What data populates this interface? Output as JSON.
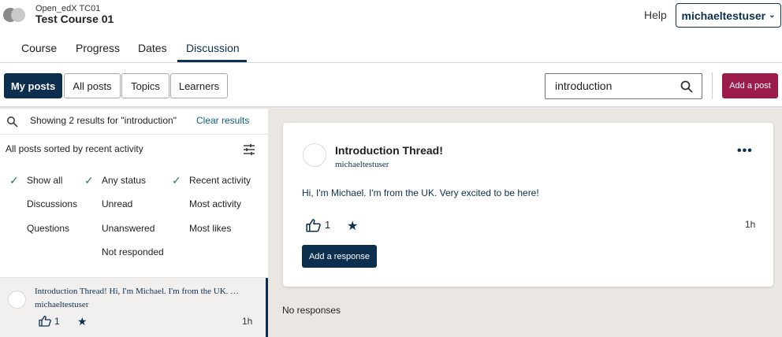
{
  "header": {
    "org": "Open_edX TC01",
    "course_title": "Test Course 01",
    "help": "Help",
    "username": "michaeltestuser",
    "username_chevron": "⌄"
  },
  "course_tabs": [
    {
      "label": "Course"
    },
    {
      "label": "Progress"
    },
    {
      "label": "Dates"
    },
    {
      "label": "Discussion"
    }
  ],
  "toolbar": {
    "pills": [
      {
        "label": "My posts"
      },
      {
        "label": "All posts"
      },
      {
        "label": "Topics"
      },
      {
        "label": "Learners"
      }
    ],
    "search_value": "introduction",
    "add_post": "Add a post"
  },
  "sidebar": {
    "results_text": "Showing 2 results for \"introduction\"",
    "clear_results": "Clear results",
    "sorted_text": "All posts sorted by recent activity",
    "filters": {
      "type": [
        "Show all",
        "Discussions",
        "Questions"
      ],
      "status": [
        "Any status",
        "Unread",
        "Unanswered",
        "Not responded"
      ],
      "sort": [
        "Recent activity",
        "Most activity",
        "Most likes"
      ]
    },
    "post": {
      "title": "Introduction Thread!",
      "preview": " Hi, I'm Michael. I'm from the UK. Very excited to be here!",
      "author": "michaeltestuser",
      "likes": "1",
      "time": "1h"
    }
  },
  "thread": {
    "title": "Introduction Thread!",
    "author": "michaeltestuser",
    "more": "•••",
    "body": "Hi, I'm Michael. I'm from the UK. Very excited to be here!",
    "likes": "1",
    "time": "1h",
    "respond_button": "Add a response",
    "no_responses": "No responses"
  },
  "colors": {
    "primary": "#0d2f4f",
    "accent": "#9b1b4b",
    "link": "#0a5f8a",
    "check": "#2a7a57"
  }
}
